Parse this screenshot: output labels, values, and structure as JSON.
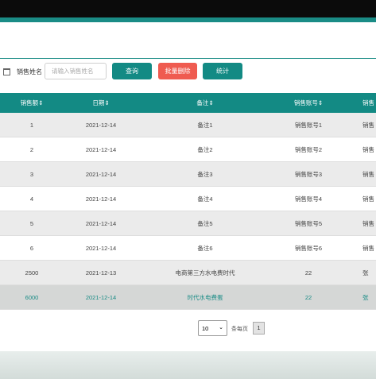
{
  "search": {
    "label": "销售姓名",
    "placeholder": "请输入销售姓名",
    "query_label": "查询",
    "delete_label": "批量删除",
    "stats_label": "统计"
  },
  "table": {
    "headers": [
      "销售额⇕",
      "日期⇕",
      "备注⇕",
      "销售账号⇕",
      "销售"
    ],
    "rows": [
      [
        "1",
        "2021-12-14",
        "备注1",
        "销售账号1",
        "销售"
      ],
      [
        "2",
        "2021-12-14",
        "备注2",
        "销售账号2",
        "销售"
      ],
      [
        "3",
        "2021-12-14",
        "备注3",
        "销售账号3",
        "销售"
      ],
      [
        "4",
        "2021-12-14",
        "备注4",
        "销售账号4",
        "销售"
      ],
      [
        "5",
        "2021-12-14",
        "备注5",
        "销售账号5",
        "销售"
      ],
      [
        "6",
        "2021-12-14",
        "备注6",
        "销售账号6",
        "销售"
      ],
      [
        "2500",
        "2021-12-13",
        "电商第三方水电费时代",
        "22",
        "张"
      ],
      [
        "6000",
        "2021-12-14",
        "时代水电费蛋",
        "22",
        "张"
      ]
    ]
  },
  "pager": {
    "page_size": "10",
    "per_page_label": "条每页",
    "current_page": "1"
  },
  "colors": {
    "accent": "#138a84",
    "danger": "#ef5b50"
  }
}
